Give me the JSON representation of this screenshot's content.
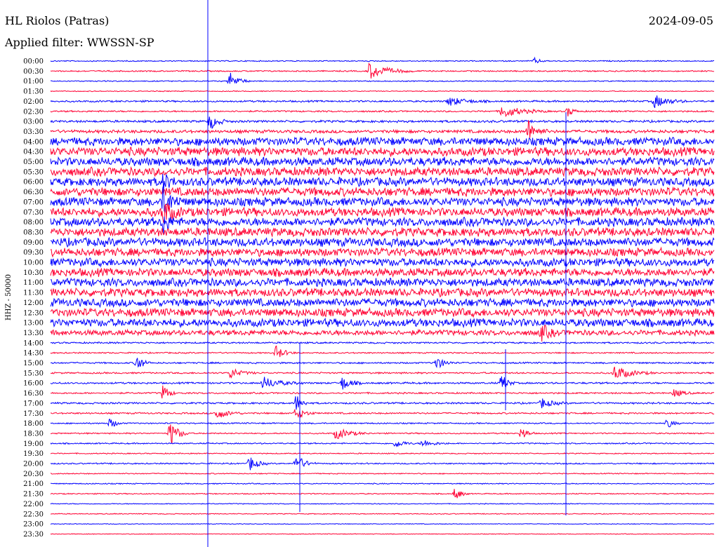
{
  "header": {
    "station": "HL Riolos (Patras)",
    "date": "2024-09-05",
    "filter": "Applied filter: WWSSN-SP"
  },
  "chart_data": {
    "type": "helicorder",
    "title": "HL Riolos (Patras)",
    "subtitle": "Applied filter: WWSSN-SP",
    "date": "2024-09-05",
    "ylabel": "HHZ - 50000",
    "line_colors": [
      "#0000ff",
      "#ff0033"
    ],
    "rows": [
      {
        "label": "00:00",
        "noise": 0.12
      },
      {
        "label": "00:30",
        "noise": 0.15
      },
      {
        "label": "01:00",
        "noise": 0.12
      },
      {
        "label": "01:30",
        "noise": 0.1
      },
      {
        "label": "02:00",
        "noise": 0.2
      },
      {
        "label": "02:30",
        "noise": 0.18
      },
      {
        "label": "03:00",
        "noise": 0.25
      },
      {
        "label": "03:30",
        "noise": 0.35
      },
      {
        "label": "04:00",
        "noise": 0.9
      },
      {
        "label": "04:30",
        "noise": 0.95
      },
      {
        "label": "05:00",
        "noise": 0.95
      },
      {
        "label": "05:30",
        "noise": 0.95
      },
      {
        "label": "06:00",
        "noise": 0.95
      },
      {
        "label": "06:30",
        "noise": 0.95
      },
      {
        "label": "07:00",
        "noise": 0.95
      },
      {
        "label": "07:30",
        "noise": 0.95
      },
      {
        "label": "08:00",
        "noise": 0.95
      },
      {
        "label": "08:30",
        "noise": 0.95
      },
      {
        "label": "09:00",
        "noise": 0.95
      },
      {
        "label": "09:30",
        "noise": 0.9
      },
      {
        "label": "10:00",
        "noise": 0.9
      },
      {
        "label": "10:30",
        "noise": 0.9
      },
      {
        "label": "11:00",
        "noise": 0.9
      },
      {
        "label": "11:30",
        "noise": 0.9
      },
      {
        "label": "12:00",
        "noise": 0.9
      },
      {
        "label": "12:30",
        "noise": 0.9
      },
      {
        "label": "13:00",
        "noise": 0.9
      },
      {
        "label": "13:30",
        "noise": 0.6
      },
      {
        "label": "14:00",
        "noise": 0.18
      },
      {
        "label": "14:30",
        "noise": 0.15
      },
      {
        "label": "15:00",
        "noise": 0.18
      },
      {
        "label": "15:30",
        "noise": 0.18
      },
      {
        "label": "16:00",
        "noise": 0.2
      },
      {
        "label": "16:30",
        "noise": 0.18
      },
      {
        "label": "17:00",
        "noise": 0.2
      },
      {
        "label": "17:30",
        "noise": 0.18
      },
      {
        "label": "18:00",
        "noise": 0.15
      },
      {
        "label": "18:30",
        "noise": 0.15
      },
      {
        "label": "19:00",
        "noise": 0.15
      },
      {
        "label": "19:30",
        "noise": 0.12
      },
      {
        "label": "20:00",
        "noise": 0.15
      },
      {
        "label": "20:30",
        "noise": 0.12
      },
      {
        "label": "21:00",
        "noise": 0.12
      },
      {
        "label": "21:30",
        "noise": 0.12
      },
      {
        "label": "22:00",
        "noise": 0.1
      },
      {
        "label": "22:30",
        "noise": 0.1
      },
      {
        "label": "23:00",
        "noise": 0.08
      },
      {
        "label": "23:30",
        "noise": 0.08
      }
    ],
    "bursts": [
      {
        "row": 0,
        "t": 0.73,
        "amp": 0.6,
        "dur": 0.02
      },
      {
        "row": 1,
        "t": 0.48,
        "amp": 1.6,
        "dur": 0.07
      },
      {
        "row": 2,
        "t": 0.27,
        "amp": 1.9,
        "dur": 0.03
      },
      {
        "row": 4,
        "t": 0.6,
        "amp": 0.9,
        "dur": 0.06
      },
      {
        "row": 4,
        "t": 0.91,
        "amp": 1.3,
        "dur": 0.05
      },
      {
        "row": 5,
        "t": 0.68,
        "amp": 1.3,
        "dur": 0.07
      },
      {
        "row": 5,
        "t": 0.78,
        "amp": 1.0,
        "dur": 0.02
      },
      {
        "row": 6,
        "t": 0.24,
        "amp": 1.6,
        "dur": 0.03
      },
      {
        "row": 7,
        "t": 0.72,
        "amp": 2.2,
        "dur": 0.03
      },
      {
        "row": 12,
        "t": 0.17,
        "amp": 1.8,
        "dur": 0.02
      },
      {
        "row": 14,
        "t": 0.17,
        "amp": 2.8,
        "dur": 0.03
      },
      {
        "row": 15,
        "t": 0.17,
        "amp": 2.5,
        "dur": 0.03
      },
      {
        "row": 16,
        "t": 0.17,
        "amp": 2.2,
        "dur": 0.02
      },
      {
        "row": 27,
        "t": 0.74,
        "amp": 1.5,
        "dur": 0.03
      },
      {
        "row": 29,
        "t": 0.34,
        "amp": 1.4,
        "dur": 0.03
      },
      {
        "row": 30,
        "t": 0.13,
        "amp": 2.0,
        "dur": 0.02
      },
      {
        "row": 30,
        "t": 0.58,
        "amp": 1.4,
        "dur": 0.03
      },
      {
        "row": 31,
        "t": 0.27,
        "amp": 1.1,
        "dur": 0.04
      },
      {
        "row": 31,
        "t": 0.85,
        "amp": 1.4,
        "dur": 0.06
      },
      {
        "row": 32,
        "t": 0.32,
        "amp": 1.2,
        "dur": 0.06
      },
      {
        "row": 32,
        "t": 0.44,
        "amp": 1.4,
        "dur": 0.03
      },
      {
        "row": 32,
        "t": 0.68,
        "amp": 2.0,
        "dur": 0.02
      },
      {
        "row": 33,
        "t": 0.17,
        "amp": 1.9,
        "dur": 0.02
      },
      {
        "row": 33,
        "t": 0.94,
        "amp": 0.9,
        "dur": 0.03
      },
      {
        "row": 34,
        "t": 0.37,
        "amp": 1.9,
        "dur": 0.02
      },
      {
        "row": 34,
        "t": 0.74,
        "amp": 1.0,
        "dur": 0.04
      },
      {
        "row": 35,
        "t": 0.25,
        "amp": 1.2,
        "dur": 0.04
      },
      {
        "row": 35,
        "t": 0.37,
        "amp": 1.3,
        "dur": 0.03
      },
      {
        "row": 36,
        "t": 0.09,
        "amp": 1.2,
        "dur": 0.02
      },
      {
        "row": 36,
        "t": 0.93,
        "amp": 1.1,
        "dur": 0.02
      },
      {
        "row": 37,
        "t": 0.18,
        "amp": 2.7,
        "dur": 0.03
      },
      {
        "row": 37,
        "t": 0.43,
        "amp": 1.2,
        "dur": 0.05
      },
      {
        "row": 37,
        "t": 0.71,
        "amp": 1.5,
        "dur": 0.02
      },
      {
        "row": 38,
        "t": 0.52,
        "amp": 0.9,
        "dur": 0.03
      },
      {
        "row": 38,
        "t": 0.56,
        "amp": 0.8,
        "dur": 0.04
      },
      {
        "row": 40,
        "t": 0.3,
        "amp": 1.5,
        "dur": 0.03
      },
      {
        "row": 40,
        "t": 0.37,
        "amp": 1.9,
        "dur": 0.03
      },
      {
        "row": 43,
        "t": 0.61,
        "amp": 1.5,
        "dur": 0.02
      }
    ]
  }
}
